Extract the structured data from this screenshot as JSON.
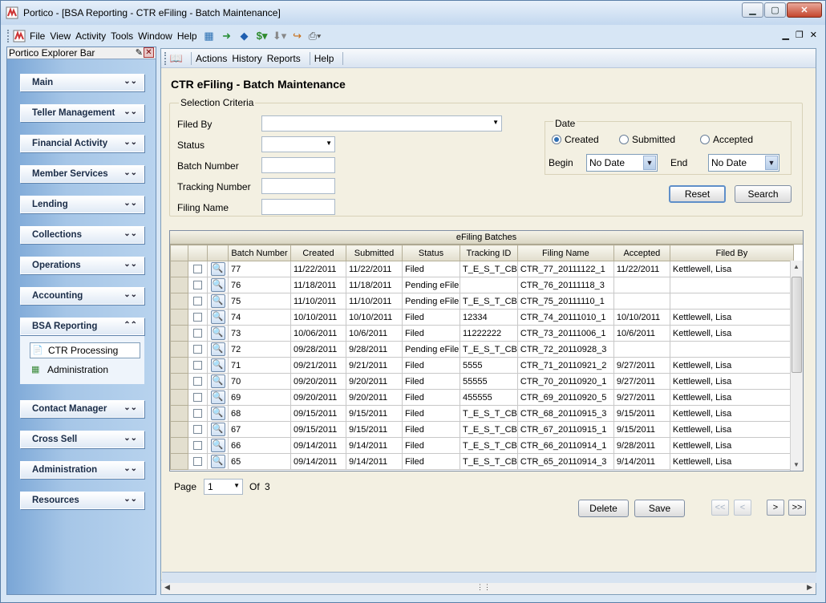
{
  "window": {
    "title": "Portico - [BSA Reporting - CTR eFiling - Batch Maintenance]"
  },
  "menu": [
    "File",
    "View",
    "Activity",
    "Tools",
    "Window",
    "Help"
  ],
  "explorer": {
    "title": "Portico Explorer Bar",
    "groups": [
      "Main",
      "Teller Management",
      "Financial Activity",
      "Member Services",
      "Lending",
      "Collections",
      "Operations",
      "Accounting",
      "BSA Reporting",
      "Contact Manager",
      "Cross Sell",
      "Administration",
      "Resources"
    ],
    "bsa_items": [
      "CTR Processing",
      "Administration"
    ]
  },
  "toolbar": {
    "items": [
      "Actions",
      "History",
      "Reports",
      "Help"
    ]
  },
  "page": {
    "title": "CTR eFiling - Batch Maintenance"
  },
  "criteria": {
    "legend": "Selection Criteria",
    "filed_by": "Filed By",
    "status": "Status",
    "batch_number": "Batch Number",
    "tracking_number": "Tracking Number",
    "filing_name": "Filing Name"
  },
  "date": {
    "legend": "Date",
    "options": [
      "Created",
      "Submitted",
      "Accepted"
    ],
    "selected": "Created",
    "begin_label": "Begin",
    "begin_value": "No Date",
    "end_label": "End",
    "end_value": "No Date"
  },
  "buttons": {
    "reset": "Reset",
    "search": "Search",
    "delete": "Delete",
    "save": "Save"
  },
  "grid": {
    "caption": "eFiling Batches",
    "columns": [
      "Batch Number",
      "Created",
      "Submitted",
      "Status",
      "Tracking ID",
      "Filing Name",
      "Accepted",
      "Filed By"
    ],
    "rows": [
      [
        "77",
        "11/22/2011",
        "11/22/2011",
        "Filed",
        "T_E_S_T_CB",
        "CTR_77_20111122_1",
        "11/22/2011",
        "Kettlewell, Lisa"
      ],
      [
        "76",
        "11/18/2011",
        "11/18/2011",
        "Pending eFile",
        "",
        "CTR_76_20111118_3",
        "",
        ""
      ],
      [
        "75",
        "11/10/2011",
        "11/10/2011",
        "Pending eFile",
        "T_E_S_T_CB",
        "CTR_75_20111110_1",
        "",
        ""
      ],
      [
        "74",
        "10/10/2011",
        "10/10/2011",
        "Filed",
        "12334",
        "CTR_74_20111010_1",
        "10/10/2011",
        "Kettlewell, Lisa"
      ],
      [
        "73",
        "10/06/2011",
        "10/6/2011",
        "Filed",
        "11222222",
        "CTR_73_20111006_1",
        "10/6/2011",
        "Kettlewell, Lisa"
      ],
      [
        "72",
        "09/28/2011",
        "9/28/2011",
        "Pending eFile",
        "T_E_S_T_CB",
        "CTR_72_20110928_3",
        "",
        ""
      ],
      [
        "71",
        "09/21/2011",
        "9/21/2011",
        "Filed",
        "5555",
        "CTR_71_20110921_2",
        "9/27/2011",
        "Kettlewell, Lisa"
      ],
      [
        "70",
        "09/20/2011",
        "9/20/2011",
        "Filed",
        "55555",
        "CTR_70_20110920_1",
        "9/27/2011",
        "Kettlewell, Lisa"
      ],
      [
        "69",
        "09/20/2011",
        "9/20/2011",
        "Filed",
        "455555",
        "CTR_69_20110920_5",
        "9/27/2011",
        "Kettlewell, Lisa"
      ],
      [
        "68",
        "09/15/2011",
        "9/15/2011",
        "Filed",
        "T_E_S_T_CB",
        "CTR_68_20110915_3",
        "9/15/2011",
        "Kettlewell, Lisa"
      ],
      [
        "67",
        "09/15/2011",
        "9/15/2011",
        "Filed",
        "T_E_S_T_CB",
        "CTR_67_20110915_1",
        "9/15/2011",
        "Kettlewell, Lisa"
      ],
      [
        "66",
        "09/14/2011",
        "9/14/2011",
        "Filed",
        "T_E_S_T_CB",
        "CTR_66_20110914_1",
        "9/28/2011",
        "Kettlewell, Lisa"
      ],
      [
        "65",
        "09/14/2011",
        "9/14/2011",
        "Filed",
        "T_E_S_T_CB",
        "CTR_65_20110914_3",
        "9/14/2011",
        "Kettlewell, Lisa"
      ]
    ]
  },
  "pager": {
    "page_label": "Page",
    "page_value": "1",
    "of_label": "Of",
    "total": "3"
  },
  "nav": {
    "first": "<<",
    "prev": "<",
    "next": ">",
    "last": ">>"
  }
}
